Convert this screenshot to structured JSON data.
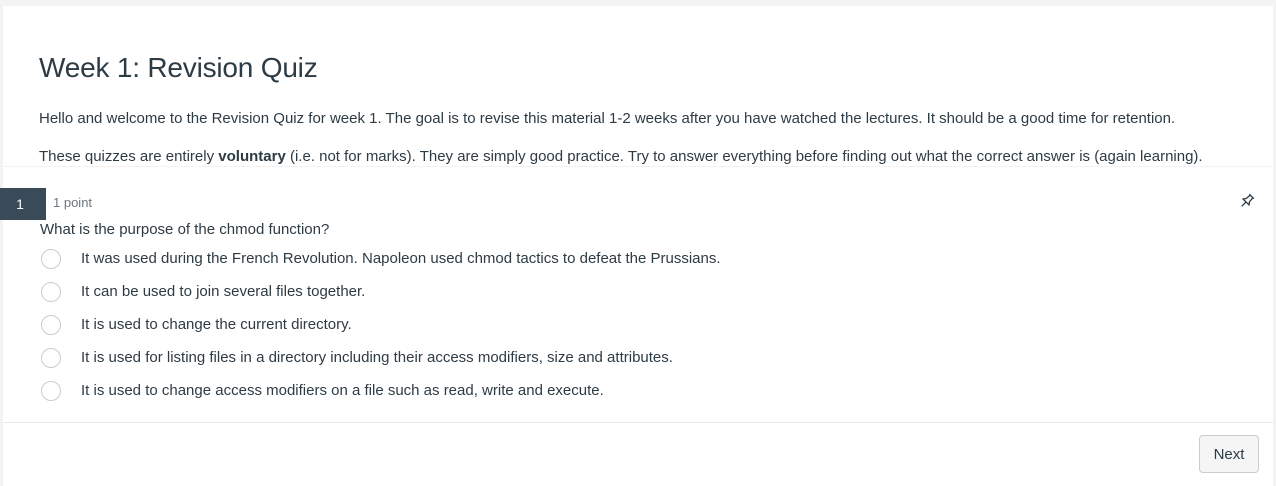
{
  "quiz": {
    "title": "Week 1: Revision Quiz",
    "intro_1": "Hello and welcome to the Revision Quiz for week 1. The goal is to revise this material 1-2 weeks after you have watched the lectures. It should be a good time for retention.",
    "intro_2_before": "These quizzes are entirely ",
    "intro_2_bold": "voluntary",
    "intro_2_after": " (i.e. not for marks). They are simply good practice. Try to answer everything before finding out what the correct answer is (again learning)."
  },
  "question": {
    "number": "1",
    "points": "1 point",
    "text": "What is the purpose of the chmod function?",
    "answers": [
      {
        "label": "It was used during the French Revolution. Napoleon used chmod tactics to defeat the Prussians."
      },
      {
        "label": "It can be used to join several files together."
      },
      {
        "label": "It is used to change the current directory."
      },
      {
        "label": "It is used for listing files in a directory including their access modifiers, size and attributes."
      },
      {
        "label": "It is used to change access modifiers on a file such as read, write and execute."
      }
    ],
    "pin_icon": "pin-icon"
  },
  "footer": {
    "next_label": "Next"
  },
  "colors": {
    "text": "#2d3b45",
    "question_number_bg": "#394b58",
    "muted": "#6b7780",
    "radio_border": "#c7cdd1"
  }
}
